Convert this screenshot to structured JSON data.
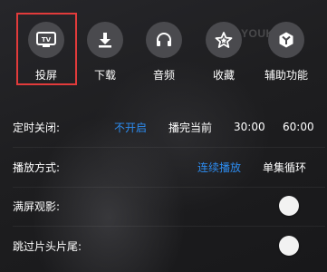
{
  "watermark": "YOUKU",
  "quick_actions": [
    {
      "label": "投屏",
      "icon": "tv-cast-icon"
    },
    {
      "label": "下载",
      "icon": "download-icon"
    },
    {
      "label": "音频",
      "icon": "headphones-icon"
    },
    {
      "label": "收藏",
      "icon": "star-icon"
    },
    {
      "label": "辅助功能",
      "icon": "assist-icon"
    }
  ],
  "tv_icon_text": "TV",
  "timer": {
    "label": "定时关闭:",
    "options": [
      "不开启",
      "播完当前",
      "30:00",
      "60:00"
    ],
    "selected": "不开启"
  },
  "playback_mode": {
    "label": "播放方式:",
    "options": [
      "连续播放",
      "单集循环"
    ],
    "selected": "连续播放"
  },
  "fullscreen": {
    "label": "满屏观影:",
    "enabled": false
  },
  "skip_intro": {
    "label": "跳过片头片尾:",
    "enabled": false
  },
  "colors": {
    "accent": "#2d8cf0",
    "highlight_box": "#e23b3b",
    "background": "#1c1c1e"
  }
}
